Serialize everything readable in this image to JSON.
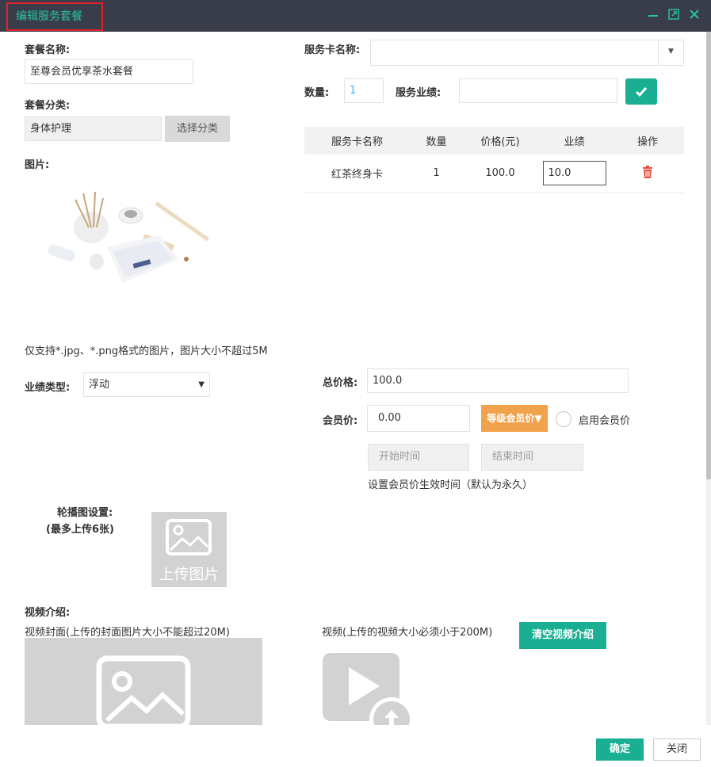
{
  "window": {
    "title": "编辑服务套餐"
  },
  "left": {
    "package_name_label": "套餐名称:",
    "package_name_value": "至尊会员优享茶水套餐",
    "category_label": "套餐分类:",
    "category_value": "身体护理",
    "choose_category_btn": "选择分类",
    "image_label": "图片:",
    "image_hint": "仅支持*.jpg、*.png格式的图片，图片大小不超过5M",
    "perf_type_label": "业绩类型:",
    "perf_type_value": "浮动",
    "carousel_label": "轮播图设置:",
    "carousel_sub": "(最多上传6张)",
    "upload_image_text": "上传图片",
    "video_intro_label": "视频介绍:",
    "video_cover_hint": "视频封面(上传的封面图片大小不能超过20M)"
  },
  "right": {
    "card_name_label": "服务卡名称:",
    "card_name_value": "",
    "qty_label": "数量:",
    "qty_value": "1",
    "perf_label": "服务业绩:",
    "perf_value": "",
    "table": {
      "headers": [
        "服务卡名称",
        "数量",
        "价格(元)",
        "业绩",
        "操作"
      ],
      "rows": [
        {
          "name": "红茶终身卡",
          "qty": "1",
          "price": "100.0",
          "perf": "10.0"
        }
      ]
    },
    "total_label": "总价格:",
    "total_value": "100.0",
    "member_price_label": "会员价:",
    "member_price_value": "0.00",
    "level_btn": "等级会员价",
    "enable_member_label": "启用会员价",
    "start_time_placeholder": "开始时间",
    "end_time_placeholder": "结束时间",
    "effective_hint": "设置会员价生效时间（默认为永久）",
    "video_hint": "视频(上传的视频大小必须小于200M)",
    "clear_video_btn": "清空视频介绍"
  },
  "footer": {
    "confirm": "确定",
    "close": "关闭"
  },
  "colors": {
    "accent": "#1aae93",
    "title_text": "#25c2a6",
    "orange": "#f0a24c",
    "delete": "#e84c3d",
    "titlebar": "#393d49"
  }
}
